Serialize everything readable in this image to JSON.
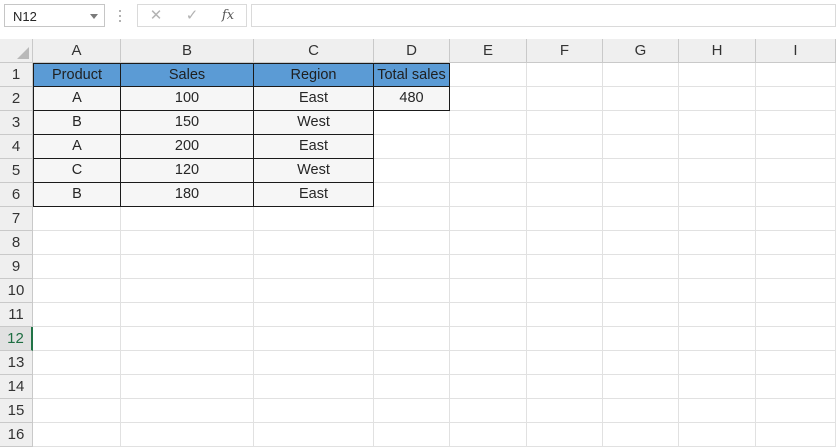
{
  "formula_bar": {
    "name_box": "N12",
    "cancel_icon": "cancel-icon",
    "enter_icon": "checkmark-icon",
    "fx_label": "fx",
    "formula": ""
  },
  "sheet": {
    "columns": [
      "A",
      "B",
      "C",
      "D",
      "E",
      "F",
      "G",
      "H",
      "I"
    ],
    "rows": [
      "1",
      "2",
      "3",
      "4",
      "5",
      "6",
      "7",
      "8",
      "9",
      "10",
      "11",
      "12",
      "13",
      "14",
      "15",
      "16"
    ],
    "active_row": "12",
    "colors": {
      "header_fill": "#5b9bd5",
      "data_fill": "#f6f6f6",
      "active_accent": "#217346"
    },
    "cells": {
      "A1": "Product",
      "B1": "Sales",
      "C1": "Region",
      "D1": "Total sales",
      "A2": "A",
      "B2": "100",
      "C2": "East",
      "D2": "480",
      "A3": "B",
      "B3": "150",
      "C3": "West",
      "A4": "A",
      "B4": "200",
      "C4": "East",
      "A5": "C",
      "B5": "120",
      "C5": "West",
      "A6": "B",
      "B6": "180",
      "C6": "East"
    }
  }
}
